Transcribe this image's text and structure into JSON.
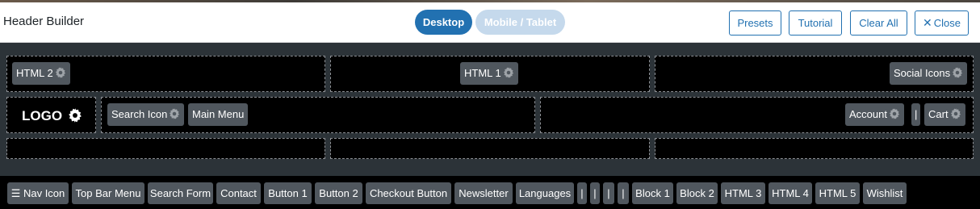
{
  "header": {
    "title": "Header Builder",
    "view_toggle": {
      "desktop": "Desktop",
      "mobile": "Mobile / Tablet",
      "active": "Desktop"
    },
    "buttons": {
      "presets": "Presets",
      "tutorial": "Tutorial",
      "clear_all": "Clear All",
      "close": "Close"
    },
    "colors": {
      "accent": "#2271b1",
      "toggle_inactive": "#c5d9ec"
    }
  },
  "builder": {
    "colors": {
      "background": "#2c3338",
      "cell": "#000000",
      "chip": "#50575e"
    },
    "top_row": {
      "left": {
        "items": [
          "HTML 2"
        ]
      },
      "center": {
        "items": [
          "HTML 1"
        ]
      },
      "right": {
        "items": [
          "Social Icons"
        ]
      }
    },
    "main_row": {
      "logo": "LOGO",
      "left": {
        "items": [
          "Search Icon",
          "Main Menu"
        ]
      },
      "right": {
        "items": [
          "Account",
          "|",
          "Cart"
        ]
      }
    },
    "bottom_row": {
      "left": {
        "items": []
      },
      "center": {
        "items": []
      },
      "right": {
        "items": []
      }
    }
  },
  "tray": {
    "items": [
      "☰ Nav Icon",
      "Top Bar Menu",
      "Search Form",
      "Contact",
      "Button 1",
      "Button 2",
      "Checkout Button",
      "Newsletter",
      "Languages",
      "|",
      "|",
      "|",
      "|",
      "Block 1",
      "Block 2",
      "HTML 3",
      "HTML 4",
      "HTML 5",
      "Wishlist"
    ]
  }
}
